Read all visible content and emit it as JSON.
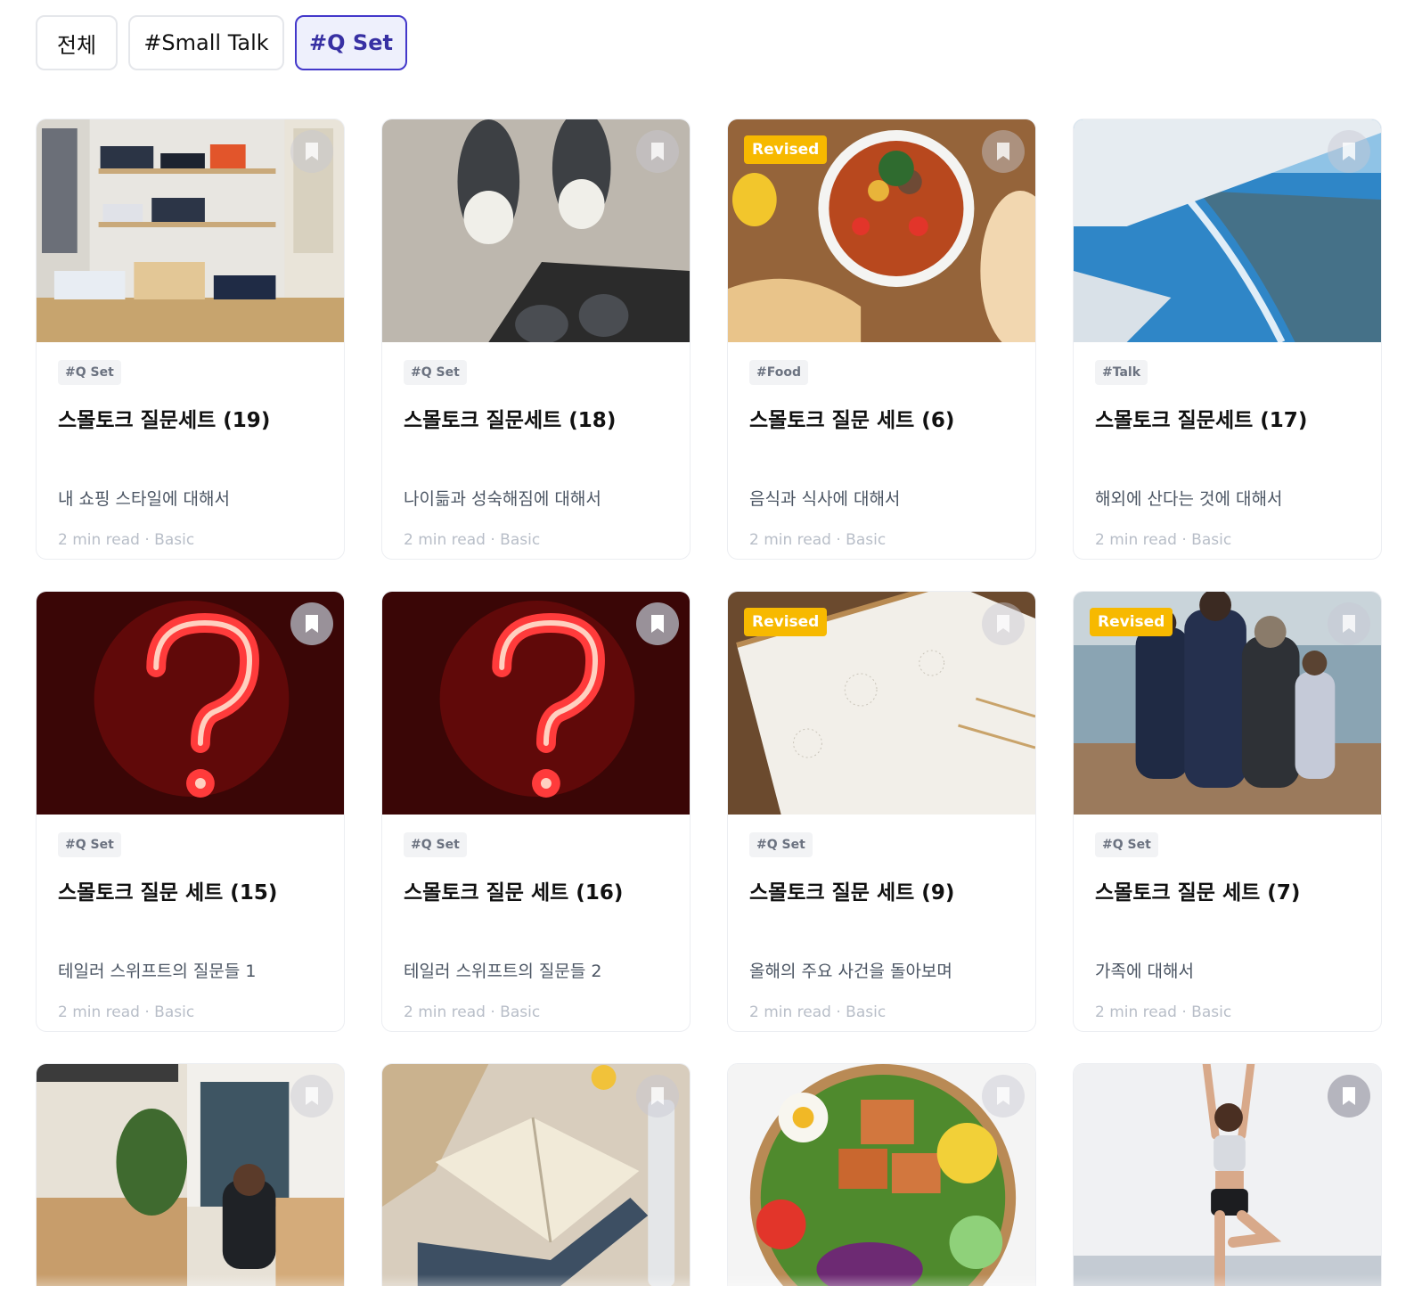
{
  "filters": [
    {
      "label": "전체"
    },
    {
      "label": "#Small Talk"
    },
    {
      "label": "#Q Set"
    }
  ],
  "cards": [
    {
      "tag": "#Q Set",
      "title": "스몰토크 질문세트 (19)",
      "desc": "내 쇼핑 스타일에 대해서",
      "meta": "2 min read · Basic",
      "revised": "",
      "image": "clothing-store-photo"
    },
    {
      "tag": "#Q Set",
      "title": "스몰토크 질문세트 (18)",
      "desc": "나이듦과 성숙해짐에 대해서",
      "meta": "2 min read · Basic",
      "revised": "",
      "image": "sneakers-photo"
    },
    {
      "tag": "#Food",
      "title": "스몰토크 질문 세트 (6)",
      "desc": "음식과 식사에 대해서",
      "meta": "2 min read · Basic",
      "revised": "Revised",
      "image": "stew-bowl-photo"
    },
    {
      "tag": "#Talk",
      "title": "스몰토크 질문세트 (17)",
      "desc": "해외에 산다는 것에 대해서",
      "meta": "2 min read · Basic",
      "revised": "",
      "image": "airplane-wing-photo"
    },
    {
      "tag": "#Q Set",
      "title": "스몰토크 질문 세트 (15)",
      "desc": "테일러 스위프트의 질문들 1",
      "meta": "2 min read · Basic",
      "revised": "",
      "image": "neon-question-mark-photo"
    },
    {
      "tag": "#Q Set",
      "title": "스몰토크 질문 세트 (16)",
      "desc": "테일러 스위프트의 질문들 2",
      "meta": "2 min read · Basic",
      "revised": "",
      "image": "neon-question-mark-photo"
    },
    {
      "tag": "#Q Set",
      "title": "스몰토크 질문 세트 (9)",
      "desc": "올해의 주요 사건을 돌아보며",
      "meta": "2 min read · Basic",
      "revised": "Revised",
      "image": "planner-photo"
    },
    {
      "tag": "#Q Set",
      "title": "스몰토크 질문 세트 (7)",
      "desc": "가족에 대해서",
      "meta": "2 min read · Basic",
      "revised": "Revised",
      "image": "family-beach-photo"
    },
    {
      "image": "cafe-laptop-photo"
    },
    {
      "image": "open-book-photo"
    },
    {
      "image": "salad-bowl-photo"
    },
    {
      "image": "yoga-beach-photo"
    }
  ],
  "colors": {
    "accent": "#3730a3",
    "revised_badge": "#f7b900"
  }
}
